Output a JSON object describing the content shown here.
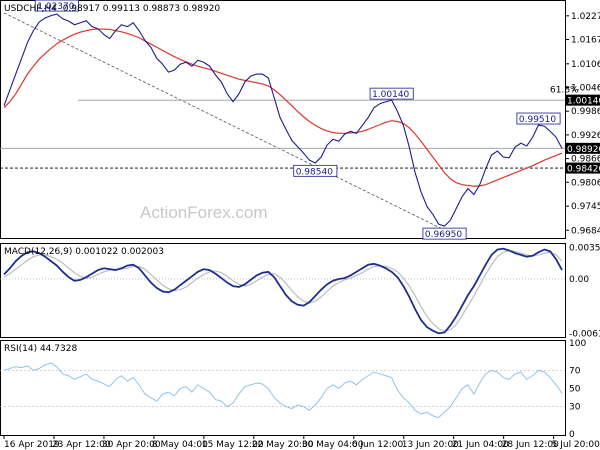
{
  "header": {
    "symbol_timeframe": "USDCHF,H4",
    "ohlc": "0.98917 0.99113 0.98873 0.98920"
  },
  "watermark": "ActionForex.com",
  "colors": {
    "price": "#1c1c8e",
    "ma": "#e0352b",
    "macd": "#1c2f8e",
    "signal": "#bdbdbd",
    "rsi": "#8fc3ec",
    "price_label_bg": "#000000",
    "grid_dash": "#b8b8b8"
  },
  "chart_data": [
    {
      "type": "line",
      "pane": "price",
      "title": "USDCHF,H4 0.98917 0.99113 0.98873 0.98920",
      "y_ticks": [
        "1.02275",
        "1.01675",
        "1.01060",
        "1.00460",
        "0.99860",
        "0.99260",
        "0.98660",
        "0.98060",
        "0.97455",
        "0.96845"
      ],
      "ylim": [
        0.967,
        1.026
      ],
      "series": [
        {
          "role": "price",
          "values": [
            1.0,
            1.004,
            1.008,
            1.012,
            1.016,
            1.019,
            1.0212,
            1.0222,
            1.0228,
            1.0232,
            1.022,
            1.0214,
            1.0205,
            1.021,
            1.0215,
            1.02,
            1.0195,
            1.018,
            1.017,
            1.019,
            1.0205,
            1.02,
            1.021,
            1.019,
            1.0165,
            1.0148,
            1.012,
            1.0105,
            1.0085,
            1.009,
            1.0105,
            1.011,
            1.01,
            1.0115,
            1.011,
            1.01,
            1.0078,
            1.006,
            1.003,
            1.001,
            1.003,
            1.006,
            1.0075,
            1.008,
            1.008,
            1.007,
            1.002,
            0.997,
            0.994,
            0.9912,
            0.9896,
            0.988,
            0.9862,
            0.9855,
            0.987,
            0.99,
            0.9915,
            0.991,
            0.9928,
            0.9935,
            0.993,
            0.995,
            0.997,
            0.9995,
            1.0005,
            1.001,
            1.0014,
            0.9985,
            0.995,
            0.9895,
            0.983,
            0.9782,
            0.9745,
            0.9725,
            0.97,
            0.9695,
            0.971,
            0.974,
            0.977,
            0.979,
            0.9775,
            0.98,
            0.984,
            0.9875,
            0.9885,
            0.987,
            0.9868,
            0.9895,
            0.9905,
            0.9898,
            0.992,
            0.9951,
            0.9948,
            0.9935,
            0.992,
            0.9892
          ]
        },
        {
          "role": "moving-average",
          "values": [
            0.9995,
            1.001,
            1.003,
            1.0055,
            1.008,
            1.01,
            1.0118,
            1.0132,
            1.0145,
            1.0157,
            1.0166,
            1.0174,
            1.0181,
            1.0186,
            1.019,
            1.0193,
            1.0194,
            1.0194,
            1.0193,
            1.019,
            1.0187,
            1.0183,
            1.0178,
            1.0172,
            1.0164,
            1.0156,
            1.0148,
            1.014,
            1.0132,
            1.0124,
            1.0117,
            1.0111,
            1.0105,
            1.01,
            1.0096,
            1.0092,
            1.0087,
            1.0082,
            1.0077,
            1.0072,
            1.0067,
            1.0064,
            1.0061,
            1.0058,
            1.0055,
            1.005,
            1.004,
            1.0028,
            1.0014,
            1.0,
            0.9985,
            0.9972,
            0.996,
            0.995,
            0.9942,
            0.9936,
            0.9932,
            0.993,
            0.993,
            0.9931,
            0.9932,
            0.9935,
            0.994,
            0.9946,
            0.9952,
            0.9958,
            0.9962,
            0.996,
            0.9955,
            0.9944,
            0.9928,
            0.991,
            0.989,
            0.987,
            0.985,
            0.983,
            0.9815,
            0.9805,
            0.98,
            0.9798,
            0.9796,
            0.9797,
            0.98,
            0.9806,
            0.9812,
            0.9818,
            0.9824,
            0.983,
            0.9836,
            0.9842,
            0.9848,
            0.9855,
            0.9862,
            0.9868,
            0.9874,
            0.988
          ]
        }
      ],
      "horizontal_lines": [
        {
          "label": "0.98920",
          "value": 0.9892,
          "style": "solid-gray"
        },
        {
          "label": "1.00140",
          "value": 1.0014,
          "style": "solid-gray"
        },
        {
          "label": "0.98420",
          "value": 0.9842,
          "style": "dashed"
        }
      ],
      "annotations": [
        {
          "text": "1.02370",
          "at_index": 9,
          "value": 1.0237
        },
        {
          "text": "1.00140",
          "at_index": 66,
          "value": 1.0014
        },
        {
          "text": "0.98540",
          "at_index": 53,
          "value": 0.9854
        },
        {
          "text": "0.96950",
          "at_index": 75,
          "value": 0.9695
        },
        {
          "text": "0.99510",
          "at_index": 91,
          "value": 0.9951
        },
        {
          "text": "61.8%",
          "at_index": 95,
          "value": 1.0026
        }
      ],
      "trendline": {
        "from_index": 0,
        "from_value": 1.0235,
        "to_index": 75,
        "to_value": 0.9685
      }
    },
    {
      "type": "line",
      "pane": "macd",
      "title": "MACD(12,26,9) 0.001022 0.002003",
      "y_ticks": [
        "0.003508",
        "0.00",
        "-0.006121"
      ],
      "ylim": [
        -0.0064,
        0.0037
      ],
      "series": [
        {
          "role": "macd",
          "values": [
            0.0005,
            0.0012,
            0.002,
            0.0026,
            0.003,
            0.0031,
            0.0029,
            0.0025,
            0.002,
            0.0015,
            0.0008,
            0.0002,
            -0.0002,
            -0.0001,
            0.0002,
            0.0006,
            0.001,
            0.0012,
            0.0011,
            0.001,
            0.0012,
            0.0015,
            0.0016,
            0.0012,
            0.0004,
            -0.0004,
            -0.001,
            -0.0014,
            -0.0015,
            -0.0012,
            -0.0007,
            -0.0002,
            0.0003,
            0.0008,
            0.0011,
            0.001,
            0.0006,
            0.0001,
            -0.0004,
            -0.0008,
            -0.0009,
            -0.0006,
            -0.0001,
            0.0004,
            0.0007,
            0.0008,
            0.0002,
            -0.0008,
            -0.0018,
            -0.0025,
            -0.0029,
            -0.003,
            -0.0026,
            -0.0019,
            -0.0012,
            -0.0006,
            -0.0002,
            0.0,
            0.0001,
            0.0004,
            0.0008,
            0.0012,
            0.0016,
            0.0017,
            0.0015,
            0.0012,
            0.0008,
            0.0002,
            -0.0008,
            -0.002,
            -0.0034,
            -0.0046,
            -0.0054,
            -0.0058,
            -0.0061,
            -0.006,
            -0.0052,
            -0.0042,
            -0.003,
            -0.0018,
            -0.0008,
            0.0004,
            0.0016,
            0.0027,
            0.0033,
            0.0034,
            0.0032,
            0.0029,
            0.0027,
            0.0025,
            0.0026,
            0.003,
            0.0033,
            0.0031,
            0.0022,
            0.001
          ]
        },
        {
          "role": "signal",
          "values": [
            0.0002,
            0.0006,
            0.0011,
            0.0016,
            0.0021,
            0.0025,
            0.0027,
            0.0027,
            0.0025,
            0.0022,
            0.0018,
            0.0012,
            0.0007,
            0.0003,
            0.0001,
            0.0002,
            0.0005,
            0.0008,
            0.001,
            0.0011,
            0.0011,
            0.0012,
            0.0014,
            0.0014,
            0.0011,
            0.0005,
            -0.0001,
            -0.0007,
            -0.0011,
            -0.0013,
            -0.0012,
            -0.0009,
            -0.0004,
            0.0001,
            0.0005,
            0.0008,
            0.0009,
            0.0007,
            0.0003,
            -0.0002,
            -0.0006,
            -0.0008,
            -0.0006,
            -0.0002,
            0.0002,
            0.0005,
            0.0006,
            0.0002,
            -0.0005,
            -0.0013,
            -0.002,
            -0.0025,
            -0.0027,
            -0.0025,
            -0.002,
            -0.0014,
            -0.0008,
            -0.0004,
            -0.0001,
            0.0001,
            0.0004,
            0.0007,
            0.0011,
            0.0014,
            0.0015,
            0.0014,
            0.0012,
            0.0008,
            0.0001,
            -0.0008,
            -0.0019,
            -0.0031,
            -0.0042,
            -0.005,
            -0.0056,
            -0.0059,
            -0.0057,
            -0.0051,
            -0.0041,
            -0.003,
            -0.0019,
            -0.0007,
            0.0005,
            0.0016,
            0.0025,
            0.003,
            0.0032,
            0.0031,
            0.0029,
            0.0027,
            0.0026,
            0.0027,
            0.0029,
            0.003,
            0.0027,
            0.002
          ]
        }
      ]
    },
    {
      "type": "line",
      "pane": "rsi",
      "title": "RSI(14) 44.7328",
      "y_ticks": [
        "100",
        "70",
        "50",
        "30",
        "0"
      ],
      "ylim": [
        0,
        100
      ],
      "levels": [
        70,
        30
      ],
      "series": [
        {
          "role": "rsi",
          "values": [
            70,
            72,
            74,
            73,
            75,
            70,
            72,
            76,
            78,
            74,
            66,
            64,
            60,
            63,
            66,
            60,
            58,
            55,
            52,
            60,
            64,
            58,
            62,
            54,
            44,
            40,
            36,
            44,
            46,
            42,
            50,
            52,
            46,
            54,
            50,
            46,
            38,
            36,
            30,
            34,
            44,
            52,
            54,
            56,
            55,
            50,
            40,
            34,
            30,
            28,
            32,
            30,
            26,
            32,
            40,
            50,
            54,
            50,
            56,
            58,
            54,
            60,
            64,
            68,
            66,
            64,
            62,
            48,
            40,
            34,
            26,
            22,
            24,
            20,
            18,
            24,
            30,
            40,
            50,
            54,
            44,
            56,
            66,
            70,
            68,
            62,
            60,
            66,
            68,
            60,
            64,
            70,
            68,
            62,
            54,
            44.73
          ]
        }
      ]
    }
  ],
  "x_axis": {
    "tick_labels": [
      "16 Apr 2019",
      "23 Apr 12:00",
      "30 Apr 20:00",
      "8 May 04:00",
      "15 May 12:00",
      "22 May 20:00",
      "30 May 04:00",
      "6 Jun 12:00",
      "13 Jun 20:00",
      "21 Jun 04:00",
      "28 Jun 12:00",
      "5 Jul 20:00"
    ]
  }
}
